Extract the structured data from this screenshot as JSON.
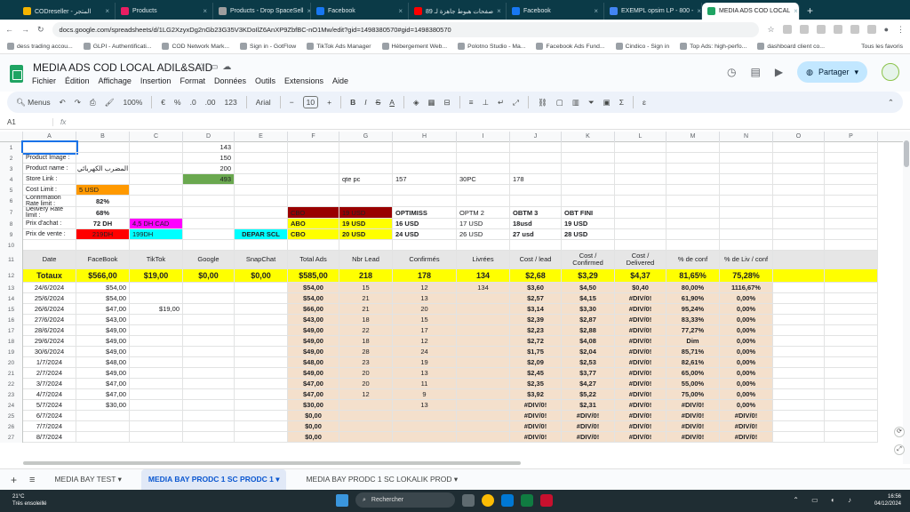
{
  "browser": {
    "tabs": [
      {
        "label": "CODreseller - المتجر",
        "color": "#f4b400"
      },
      {
        "label": "Products",
        "color": "#e91e63"
      },
      {
        "label": "Products - Drop SpaceSell",
        "color": "#9e9e9e"
      },
      {
        "label": "Facebook",
        "color": "#1877f2"
      },
      {
        "label": "89 صفحات هبوط جاهزة لـ",
        "color": "#ff0000"
      },
      {
        "label": "Facebook",
        "color": "#1877f2"
      },
      {
        "label": "EXEMPL opsim LP - 800 -",
        "color": "#4285f4"
      },
      {
        "label": "MEDIA ADS COD LOCAL",
        "color": "#1fa463"
      }
    ],
    "url": "docs.google.com/spreadsheets/d/1LG2XzyxDg2nGb23G35V3KDoIlZ6AnXP9ZbfBC-nO1Mw/edit?gid=1498380570#gid=1498380570",
    "bookmarks": [
      "dess trading accou...",
      "GLPI - Authentificati...",
      "COD Network Mark...",
      "Sign in - GotFlow",
      "TikTok Ads Manager",
      "Hébergement Web...",
      "Polotno Studio - Ma...",
      "Facebook Ads Fund...",
      "Cindico - Sign in",
      "Top Ads: high-perfo...",
      "dashboard client co..."
    ],
    "all_bookmarks": "Tous les favoris"
  },
  "doc": {
    "title": "MEDIA ADS COD LOCAL ADIL&SAID",
    "menus": [
      "Fichier",
      "Édition",
      "Affichage",
      "Insertion",
      "Format",
      "Données",
      "Outils",
      "Extensions",
      "Aide"
    ],
    "share": "Partager"
  },
  "toolbar": {
    "menus": "Menus",
    "zoom": "100%",
    "currency": "€",
    "percent": "%",
    "dec1": ".0",
    "dec2": ".00",
    "numfmt": "123",
    "font": "Arial",
    "fontsize": "10"
  },
  "formula": {
    "cellref": "A1",
    "fx": "fx"
  },
  "columns": [
    "A",
    "B",
    "C",
    "D",
    "E",
    "F",
    "G",
    "H",
    "I",
    "J",
    "K",
    "L",
    "M",
    "N",
    "O",
    "P"
  ],
  "rows": [
    {
      "n": "1",
      "cells": {
        "D": "143"
      }
    },
    {
      "n": "2",
      "cells": {
        "A": "Product Image :",
        "D": "150"
      }
    },
    {
      "n": "3",
      "cells": {
        "A": "Product name :",
        "B": "المضرب الكهربائي",
        "D": "200"
      }
    },
    {
      "n": "4",
      "cells": {
        "A": "Store Link :",
        "D": "493",
        "G": "qte pc",
        "H": "157",
        "I": "30PC",
        "J": "178"
      }
    },
    {
      "n": "5",
      "cells": {
        "A": "Cost Limit :",
        "B": "5 USD"
      }
    },
    {
      "n": "6",
      "cells": {
        "A": "Confirmation Rate limit :",
        "B": "82%"
      }
    },
    {
      "n": "7",
      "cells": {
        "A": "Delivery Rate limit :",
        "B": "68%",
        "F": "CBO",
        "G": "19 USD",
        "H": "OPTIMISS",
        "I": "OPTM 2",
        "J": "OBTM 3",
        "K": "OBT FINI"
      }
    },
    {
      "n": "8",
      "cells": {
        "A": "Prix d'achat :",
        "B": "72 DH",
        "C": "4,5 DH CAD",
        "F": "ABO",
        "G": "19 USD",
        "H": "16 USD",
        "I": "17 USD",
        "J": "18usd",
        "K": "19 USD"
      }
    },
    {
      "n": "9",
      "cells": {
        "A": "Prix de vente :",
        "B": "219DH",
        "C": "199DH",
        "E": "DEPAR SCL",
        "F": "CBO",
        "G": "20 USD",
        "H": "24 USD",
        "I": "26 USD",
        "J": "27 usd",
        "K": "28 USD"
      }
    },
    {
      "n": "10",
      "cells": {}
    },
    {
      "n": "11",
      "cells": {
        "A": "Date",
        "B": "FaceBook",
        "C": "TikTok",
        "D": "Google",
        "E": "SnapChat",
        "F": "Total Ads",
        "G": "Nbr Lead",
        "H": "Confirmés",
        "I": "Livrées",
        "J": "Cost / lead",
        "K": "Cost / Confirmed",
        "L": "Cost / Delivered",
        "M": "% de conf",
        "N": "% de Liv / conf"
      }
    },
    {
      "n": "12",
      "cells": {
        "A": "Totaux",
        "B": "$566,00",
        "C": "$19,00",
        "D": "$0,00",
        "E": "$0,00",
        "F": "$585,00",
        "G": "218",
        "H": "178",
        "I": "134",
        "J": "$2,68",
        "K": "$3,29",
        "L": "$4,37",
        "M": "81,65%",
        "N": "75,28%"
      }
    },
    {
      "n": "13",
      "cells": {
        "A": "24/6/2024",
        "B": "$54,00",
        "F": "$54,00",
        "G": "15",
        "H": "12",
        "I": "134",
        "J": "$3,60",
        "K": "$4,50",
        "L": "$0,40",
        "M": "80,00%",
        "N": "1116,67%"
      }
    },
    {
      "n": "14",
      "cells": {
        "A": "25/6/2024",
        "B": "$54,00",
        "F": "$54,00",
        "G": "21",
        "H": "13",
        "J": "$2,57",
        "K": "$4,15",
        "L": "#DIV/0!",
        "M": "61,90%",
        "N": "0,00%"
      }
    },
    {
      "n": "15",
      "cells": {
        "A": "26/6/2024",
        "B": "$47,00",
        "C": "$19,00",
        "F": "$66,00",
        "G": "21",
        "H": "20",
        "J": "$3,14",
        "K": "$3,30",
        "L": "#DIV/0!",
        "M": "95,24%",
        "N": "0,00%"
      }
    },
    {
      "n": "16",
      "cells": {
        "A": "27/6/2024",
        "B": "$43,00",
        "F": "$43,00",
        "G": "18",
        "H": "15",
        "J": "$2,39",
        "K": "$2,87",
        "L": "#DIV/0!",
        "M": "83,33%",
        "N": "0,00%"
      }
    },
    {
      "n": "17",
      "cells": {
        "A": "28/6/2024",
        "B": "$49,00",
        "F": "$49,00",
        "G": "22",
        "H": "17",
        "J": "$2,23",
        "K": "$2,88",
        "L": "#DIV/0!",
        "M": "77,27%",
        "N": "0,00%"
      }
    },
    {
      "n": "18",
      "cells": {
        "A": "29/6/2024",
        "B": "$49,00",
        "F": "$49,00",
        "G": "18",
        "H": "12",
        "J": "$2,72",
        "K": "$4,08",
        "L": "#DIV/0!",
        "M": "Dim",
        "N": "0,00%"
      }
    },
    {
      "n": "19",
      "cells": {
        "A": "30/6/2024",
        "B": "$49,00",
        "F": "$49,00",
        "G": "28",
        "H": "24",
        "J": "$1,75",
        "K": "$2,04",
        "L": "#DIV/0!",
        "M": "85,71%",
        "N": "0,00%"
      }
    },
    {
      "n": "20",
      "cells": {
        "A": "1/7/2024",
        "B": "$48,00",
        "F": "$48,00",
        "G": "23",
        "H": "19",
        "J": "$2,09",
        "K": "$2,53",
        "L": "#DIV/0!",
        "M": "82,61%",
        "N": "0,00%"
      }
    },
    {
      "n": "21",
      "cells": {
        "A": "2/7/2024",
        "B": "$49,00",
        "F": "$49,00",
        "G": "20",
        "H": "13",
        "J": "$2,45",
        "K": "$3,77",
        "L": "#DIV/0!",
        "M": "65,00%",
        "N": "0,00%"
      }
    },
    {
      "n": "22",
      "cells": {
        "A": "3/7/2024",
        "B": "$47,00",
        "F": "$47,00",
        "G": "20",
        "H": "11",
        "J": "$2,35",
        "K": "$4,27",
        "L": "#DIV/0!",
        "M": "55,00%",
        "N": "0,00%"
      }
    },
    {
      "n": "23",
      "cells": {
        "A": "4/7/2024",
        "B": "$47,00",
        "F": "$47,00",
        "G": "12",
        "H": "9",
        "J": "$3,92",
        "K": "$5,22",
        "L": "#DIV/0!",
        "M": "75,00%",
        "N": "0,00%"
      }
    },
    {
      "n": "24",
      "cells": {
        "A": "5/7/2024",
        "B": "$30,00",
        "F": "$30,00",
        "H": "13",
        "J": "#DIV/0!",
        "K": "$2,31",
        "L": "#DIV/0!",
        "M": "#DIV/0!",
        "N": "0,00%"
      }
    },
    {
      "n": "25",
      "cells": {
        "A": "6/7/2024",
        "F": "$0,00",
        "J": "#DIV/0!",
        "K": "#DIV/0!",
        "L": "#DIV/0!",
        "M": "#DIV/0!",
        "N": "#DIV/0!"
      }
    },
    {
      "n": "26",
      "cells": {
        "A": "7/7/2024",
        "F": "$0,00",
        "J": "#DIV/0!",
        "K": "#DIV/0!",
        "L": "#DIV/0!",
        "M": "#DIV/0!",
        "N": "#DIV/0!"
      }
    },
    {
      "n": "27",
      "cells": {
        "A": "8/7/2024",
        "F": "$0,00",
        "J": "#DIV/0!",
        "K": "#DIV/0!",
        "L": "#DIV/0!",
        "M": "#DIV/0!",
        "N": "#DIV/0!"
      }
    }
  ],
  "sheets": [
    "MEDIA BAY TEST",
    "MEDIA BAY PRODC 1 SC PRODC 1",
    "MEDIA BAY PRODC 1 SC LOKALIK PROD"
  ],
  "taskbar": {
    "temp": "21°C",
    "weather": "Très ensoleillé",
    "search": "Rechercher",
    "time": "16:56",
    "date": "04/12/2024"
  },
  "colors": {
    "yellow": "#ffff00",
    "orange": "#ff9900",
    "green": "#6aa84f",
    "darkred": "#990000",
    "magenta": "#ff00ff",
    "red": "#ff0000",
    "cyan": "#00ffff",
    "peach": "#f4e0cc",
    "header": "#e6e6e6"
  }
}
